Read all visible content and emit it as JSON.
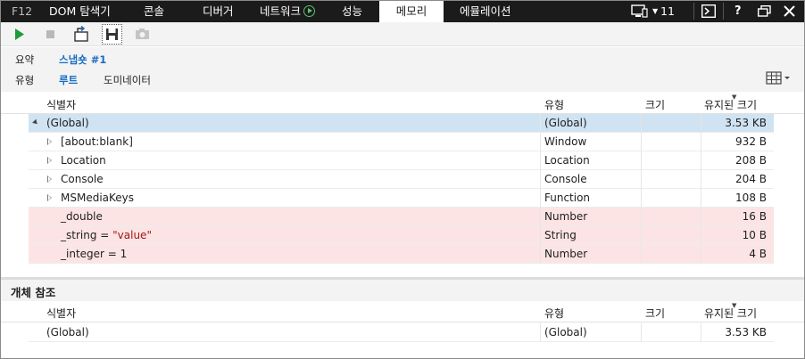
{
  "tabs": [
    {
      "label": "F12"
    },
    {
      "label": "DOM 탐색기"
    },
    {
      "label": "콘솔"
    },
    {
      "label": "디버거"
    },
    {
      "label": "네트워크"
    },
    {
      "label": "성능"
    },
    {
      "label": "메모리"
    },
    {
      "label": "에뮬레이션"
    }
  ],
  "topbar_right": {
    "device_count": "11",
    "help": "?"
  },
  "toolbar": {
    "icons": [
      "play-icon",
      "stop-icon",
      "import-snapshot-icon",
      "save-icon",
      "camera-icon"
    ]
  },
  "nav": {
    "summary": "요약",
    "snapshot": "스냅숏 #1",
    "views": [
      "유형",
      "루트",
      "도미네이터"
    ],
    "selected_view": "루트"
  },
  "columns": {
    "identifier": "식별자",
    "type": "유형",
    "size": "크기",
    "retained_size": "유지된 크기"
  },
  "rows": [
    {
      "name": "(Global)",
      "type": "(Global)",
      "size": "",
      "retained": "3.53 KB",
      "state": "selected"
    },
    {
      "name": "[about:blank]",
      "type": "Window",
      "size": "",
      "retained": "932 B",
      "state": "normal"
    },
    {
      "name": "Location",
      "type": "Location",
      "size": "",
      "retained": "208 B",
      "state": "normal"
    },
    {
      "name": "Console",
      "type": "Console",
      "size": "",
      "retained": "204 B",
      "state": "normal"
    },
    {
      "name": "MSMediaKeys",
      "type": "Function",
      "size": "",
      "retained": "108 B",
      "state": "normal"
    },
    {
      "name": "_double",
      "type": "Number",
      "size": "",
      "retained": "16 B",
      "state": "highlight"
    },
    {
      "name_prefix": "_string = ",
      "name_value": "\"value\"",
      "type": "String",
      "size": "",
      "retained": "10 B",
      "state": "highlight"
    },
    {
      "name": "_integer = 1",
      "type": "Number",
      "size": "",
      "retained": "4 B",
      "state": "highlight"
    }
  ],
  "refs": {
    "title": "개체 참조",
    "rows": [
      {
        "name": "(Global)",
        "type": "(Global)",
        "size": "",
        "retained": "3.53 KB"
      }
    ]
  },
  "colors": {
    "topbar_bg": "#1b1b1b",
    "selected_row": "#cfe3f2",
    "highlight_row": "#fde4e4",
    "accent": "#1a6cc4",
    "string_value": "#a31515"
  }
}
